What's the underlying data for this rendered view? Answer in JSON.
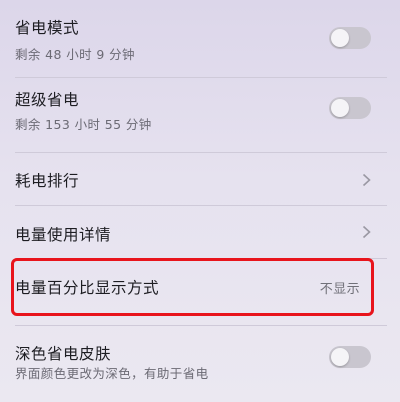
{
  "settings": {
    "power_saving_mode": {
      "title": "省电模式",
      "subtitle": "剩余 48 小时 9 分钟",
      "enabled": false
    },
    "ultra_power_saving": {
      "title": "超级省电",
      "subtitle": "剩余 153 小时 55 分钟",
      "enabled": false
    },
    "power_consumption_ranking": {
      "title": "耗电排行"
    },
    "battery_usage_details": {
      "title": "电量使用详情"
    },
    "battery_percentage_display": {
      "title": "电量百分比显示方式",
      "value": "不显示"
    },
    "dark_power_saving_theme": {
      "title": "深色省电皮肤",
      "subtitle": "界面颜色更改为深色，有助于省电",
      "enabled": false
    }
  },
  "icons": {
    "toggle": "toggle-switch",
    "chevron": "chevron-right-icon"
  },
  "colors": {
    "highlight_border": "#e8141c",
    "toggle_off_track": "#c9c6cf"
  }
}
